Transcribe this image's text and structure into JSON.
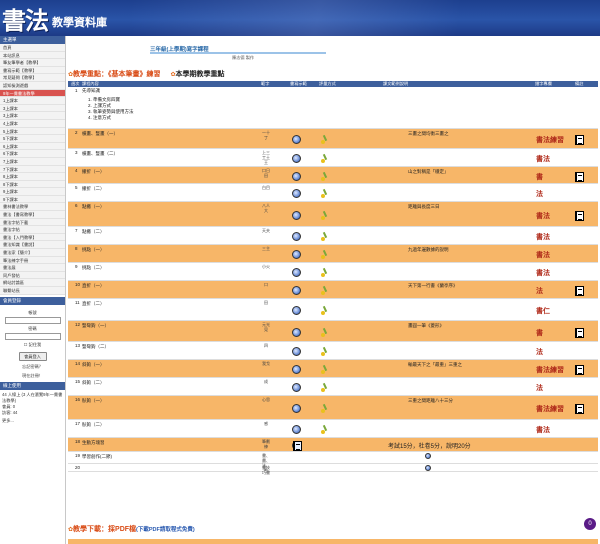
{
  "banner": {
    "logo": "書法",
    "title": "教學資料庫"
  },
  "sidebar": {
    "header": "主選單",
    "items": [
      "首頁",
      "本站訊息",
      "筆友筆學者【教學】",
      "書寫示範【教學】",
      "常見疑問【教學】",
      "認知檢測遊戲",
      "9年一貫書法教學",
      "1上課本",
      "3上課本",
      "3上課本",
      "4上課本",
      "5上課本",
      "5下課本",
      "6上課本",
      "6下課本",
      "7上課本",
      "7下課本",
      "8上課本",
      "8下課本",
      "9上課本",
      "9下課本",
      "書林書法教學",
      "書法【書寫教學】",
      "書法字帖下載",
      "書法字帖",
      "書法【入門教學】",
      "書法知識【書說】",
      "書法家【簡介】",
      "筆法練字手冊",
      "書法展",
      "同戶發帖",
      "網站討論區",
      "聯繫站長"
    ],
    "active_index": 6,
    "member_header": "會員登錄",
    "account_label": "帳號",
    "password_label": "密碼",
    "remember_label": "記住我",
    "login_button": "會員登入",
    "forgot_label": "忘記密碼？",
    "register_label": "現在註冊！",
    "online_header": "線上使用",
    "online_text": "44 人線上 (3 人在瀏覽9年一貫書法教學)",
    "member_count": "會員: 0",
    "visitor_count": "訪客: 44",
    "more_label": "更多..."
  },
  "course": {
    "title": "三年級(上學期)寫字課程",
    "author": "陳志德 製作"
  },
  "tabs": {
    "focus": "教學重點：《基本筆畫》練習",
    "semester": "本學期教學重點"
  },
  "table": {
    "headers": [
      "週次",
      "課程內容",
      "範字",
      "書寫示範",
      "評量方式",
      "課文範例說明",
      "錯字專欄",
      "備註"
    ],
    "rows": [
      {
        "week": "1",
        "content": "先導知識",
        "notes": [
          "1. 準備文房四寶",
          "2. 上課方式",
          "3. 執筆姿勢與使用方法",
          "4. 注意方式"
        ],
        "chars": "",
        "demo": false,
        "eval": false,
        "desc": "",
        "calli": "",
        "book": false,
        "hl": false
      },
      {
        "week": "2",
        "content": "橫畫、豎畫（一）",
        "chars": "一十丁",
        "demo": true,
        "eval": true,
        "desc": "三畫之間均衡三畫之",
        "calli": "書法練習",
        "book": true,
        "hl": true
      },
      {
        "week": "3",
        "content": "橫畫、豎畫（二）",
        "chars": "上三工土王",
        "demo": true,
        "eval": true,
        "desc": "",
        "calli": "書法",
        "book": false,
        "hl": false
      },
      {
        "week": "4",
        "content": "撇折（一）",
        "chars": "口日田",
        "demo": true,
        "eval": true,
        "desc": "山之對稱是「穩定」",
        "calli": "書",
        "book": true,
        "hl": true
      },
      {
        "week": "5",
        "content": "撇折（二）",
        "chars": "白目",
        "demo": true,
        "eval": true,
        "desc": "",
        "calli": "法",
        "book": false,
        "hl": false
      },
      {
        "week": "6",
        "content": "點撇（一）",
        "chars": "八人大",
        "demo": true,
        "eval": true,
        "desc": "距離與長度三日",
        "calli": "書法",
        "book": true,
        "hl": true
      },
      {
        "week": "7",
        "content": "點撇（二）",
        "chars": "天夫",
        "demo": true,
        "eval": true,
        "desc": "",
        "calli": "書法",
        "book": false,
        "hl": false
      },
      {
        "week": "8",
        "content": "挑點（一）",
        "chars": "三主",
        "demo": true,
        "eval": true,
        "desc": "九過年邊數據的說明",
        "calli": "書法",
        "book": false,
        "hl": true
      },
      {
        "week": "9",
        "content": "挑點（二）",
        "chars": "小火",
        "demo": true,
        "eval": true,
        "desc": "",
        "calli": "書法",
        "book": false,
        "hl": false
      },
      {
        "week": "10",
        "content": "直折（一）",
        "chars": "口",
        "demo": true,
        "eval": true,
        "desc": "天下第一行書《蘭亭序》",
        "calli": "法",
        "book": true,
        "hl": true
      },
      {
        "week": "11",
        "content": "直折（二）",
        "chars": "田",
        "demo": true,
        "eval": true,
        "desc": "",
        "calli": "書仁",
        "book": false,
        "hl": false
      },
      {
        "week": "12",
        "content": "豎彎鉤（一）",
        "chars": "元光見",
        "demo": true,
        "eval": true,
        "desc": "畫圓一筆《菱形》",
        "calli": "書",
        "book": true,
        "hl": true
      },
      {
        "week": "13",
        "content": "豎彎鉤（二）",
        "chars": "四",
        "demo": true,
        "eval": true,
        "desc": "",
        "calli": "法",
        "book": false,
        "hl": false
      },
      {
        "week": "14",
        "content": "斜鉤（一）",
        "chars": "我戈",
        "demo": true,
        "eval": true,
        "desc": "輸最天下之「最重」三重之",
        "calli": "書法練習",
        "book": true,
        "hl": true
      },
      {
        "week": "15",
        "content": "斜鉤（二）",
        "chars": "成",
        "demo": true,
        "eval": true,
        "desc": "",
        "calli": "法",
        "book": false,
        "hl": false
      },
      {
        "week": "16",
        "content": "臥鉤（一）",
        "chars": "心思",
        "demo": true,
        "eval": true,
        "desc": "三重之間距離八十三分",
        "calli": "書法練習",
        "book": true,
        "hl": true
      },
      {
        "week": "17",
        "content": "臥鉤（二）",
        "chars": "感",
        "demo": true,
        "eval": true,
        "desc": "",
        "calli": "書法",
        "book": false,
        "hl": false
      },
      {
        "week": "18",
        "content": "生動方塊習",
        "chars": "筆劃練",
        "demo": true,
        "eval": false,
        "desc": "考試15分，杜卷5分，說明20分",
        "calli": "",
        "book": false,
        "hl": true
      },
      {
        "week": "19",
        "content": "學習創作(二節)",
        "chars": "書、畫、法、影",
        "demo": false,
        "eval": false,
        "desc": "",
        "calli": "",
        "book": false,
        "hl": false
      },
      {
        "week": "20",
        "content": "",
        "chars": "書技巧書",
        "demo": false,
        "eval": false,
        "desc": "",
        "calli": "",
        "book": false,
        "hl": false
      }
    ],
    "row21_chars": "大書大利"
  },
  "footer": {
    "label": "教學下載：採PDF檔",
    "hint": "(下載PDF請取程式免費)"
  },
  "badge": "0"
}
